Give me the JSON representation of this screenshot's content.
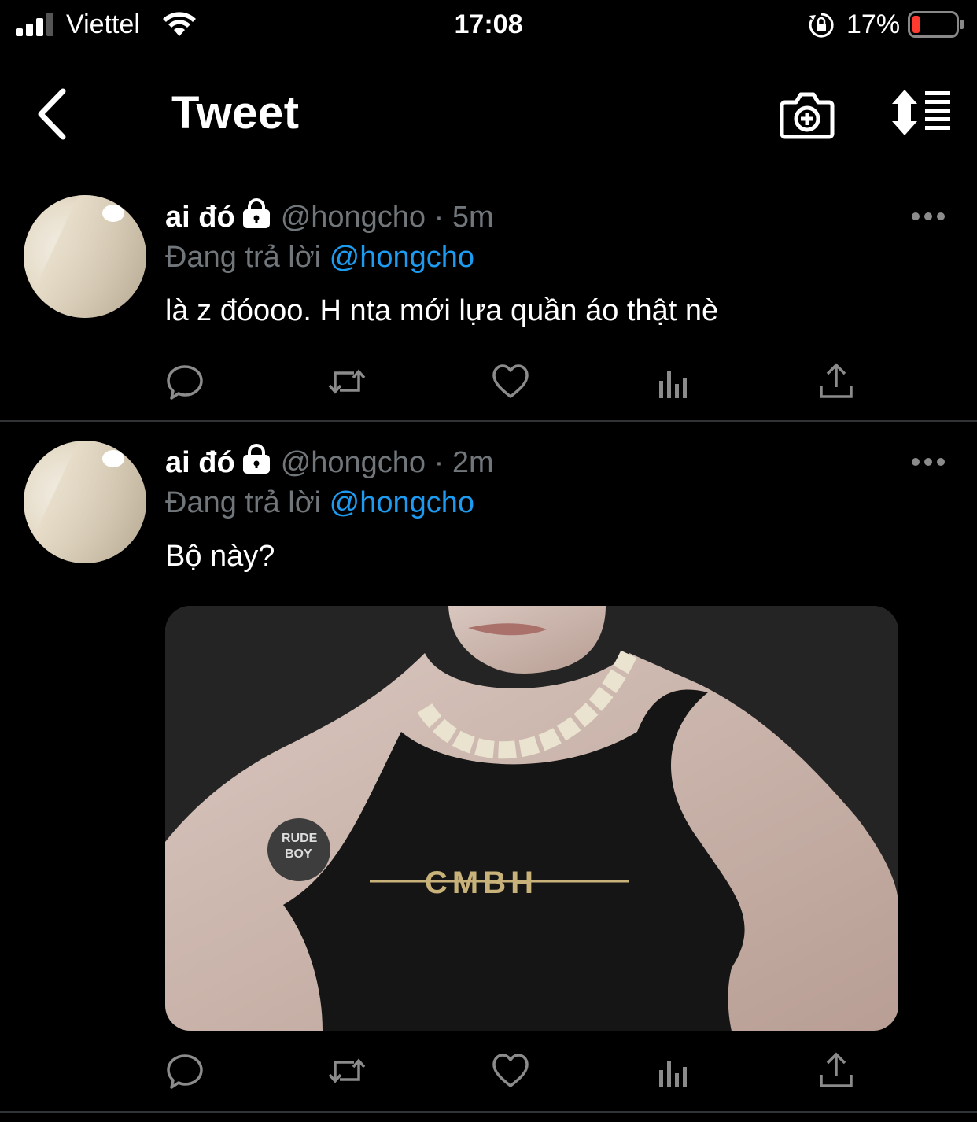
{
  "status_bar": {
    "carrier": "Viettel",
    "time": "17:08",
    "battery_percent": "17%",
    "battery_level": 0.17,
    "signal_bars": 3
  },
  "header": {
    "title": "Tweet"
  },
  "colors": {
    "background": "#000000",
    "text_primary": "#ffffff",
    "text_secondary": "#71767b",
    "link": "#1d9bf0",
    "divider": "#2f3336",
    "battery_low": "#ff3b30"
  },
  "tweets": [
    {
      "name": "ai đó",
      "handle": "@hongcho",
      "separator": "·",
      "time": "5m",
      "replying_prefix": "Đang trả lời",
      "replying_to": "@hongcho",
      "text": "là z đóooo. H nta mới lựa quần áo thật nè",
      "has_media": false
    },
    {
      "name": "ai đó",
      "handle": "@hongcho",
      "separator": "·",
      "time": "2m",
      "replying_prefix": "Đang trả lời",
      "replying_to": "@hongcho",
      "text": "Bộ này?",
      "has_media": true,
      "media": {
        "logo_text": "CMBH",
        "tattoo_text_1": "RUDE",
        "tattoo_text_2": "BOY"
      }
    }
  ],
  "icons": {
    "back": "chevron-left-icon",
    "camera": "camera-plus-icon",
    "sort": "sort-icon",
    "reply": "reply-icon",
    "retweet": "retweet-icon",
    "like": "heart-icon",
    "analytics": "analytics-icon",
    "share": "share-icon",
    "more": "more-icon",
    "lock": "lock-icon"
  }
}
